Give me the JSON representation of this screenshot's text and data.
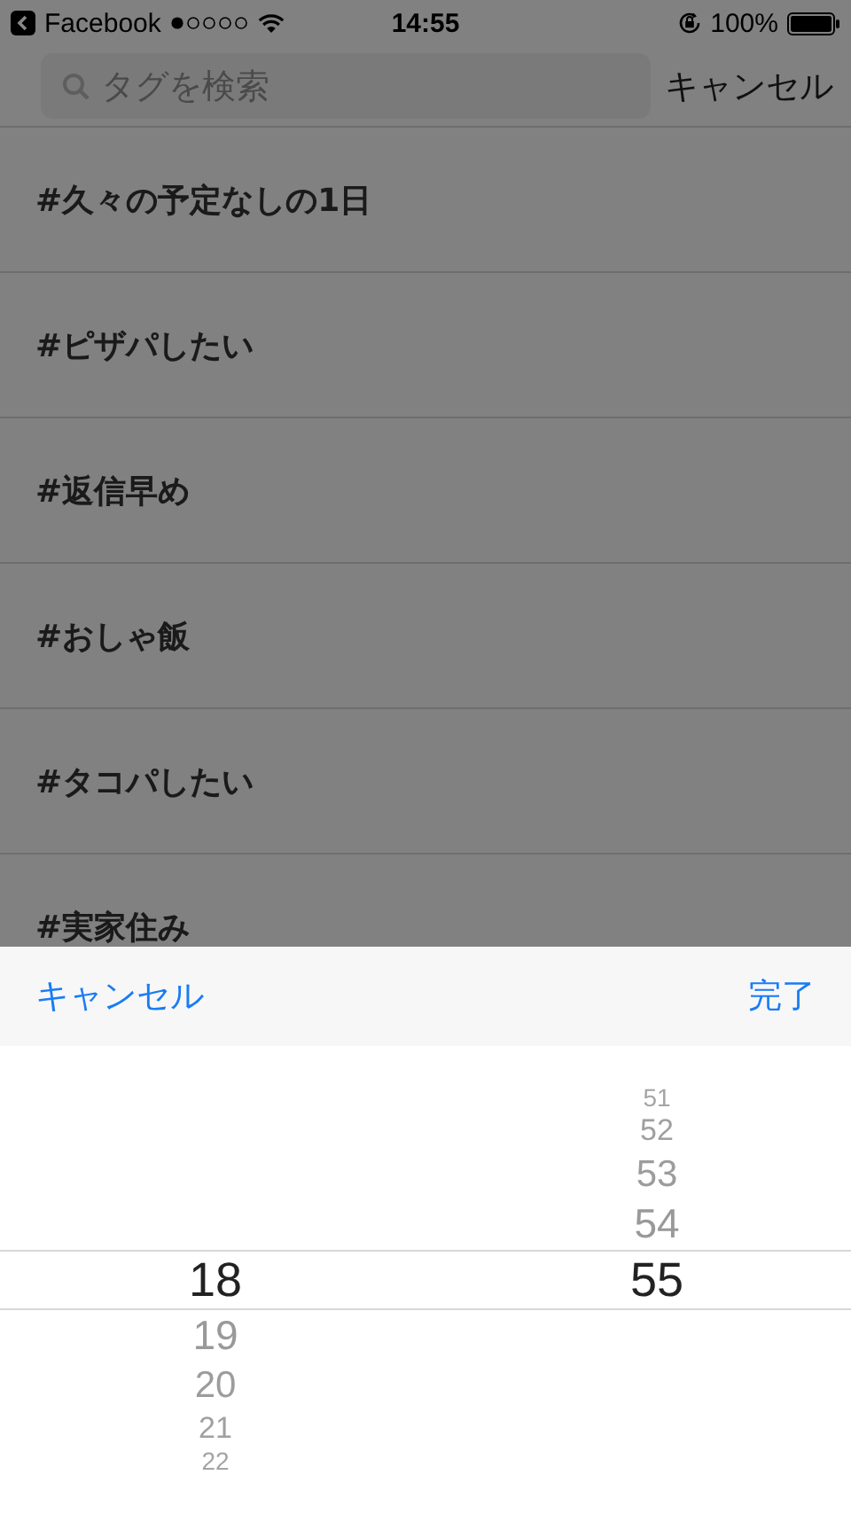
{
  "status_bar": {
    "back_app": "Facebook",
    "time": "14:55",
    "battery": "100%"
  },
  "search": {
    "placeholder": "タグを検索",
    "cancel": "キャンセル"
  },
  "tags": [
    "#久々の予定なしの1日",
    "#ピザパしたい",
    "#返信早め",
    "#おしゃ飯",
    "#タコパしたい",
    "#実家住み"
  ],
  "picker": {
    "cancel": "キャンセル",
    "done": "完了",
    "columns": [
      {
        "items": [
          {
            "text": "18",
            "selected": true
          },
          {
            "text": "19",
            "selected": false
          },
          {
            "text": "20",
            "selected": false
          },
          {
            "text": "21",
            "selected": false
          },
          {
            "text": "22",
            "selected": false
          }
        ]
      },
      {
        "items": [
          {
            "text": "51",
            "selected": false
          },
          {
            "text": "52",
            "selected": false
          },
          {
            "text": "53",
            "selected": false
          },
          {
            "text": "54",
            "selected": false
          },
          {
            "text": "55",
            "selected": true
          }
        ]
      }
    ]
  }
}
